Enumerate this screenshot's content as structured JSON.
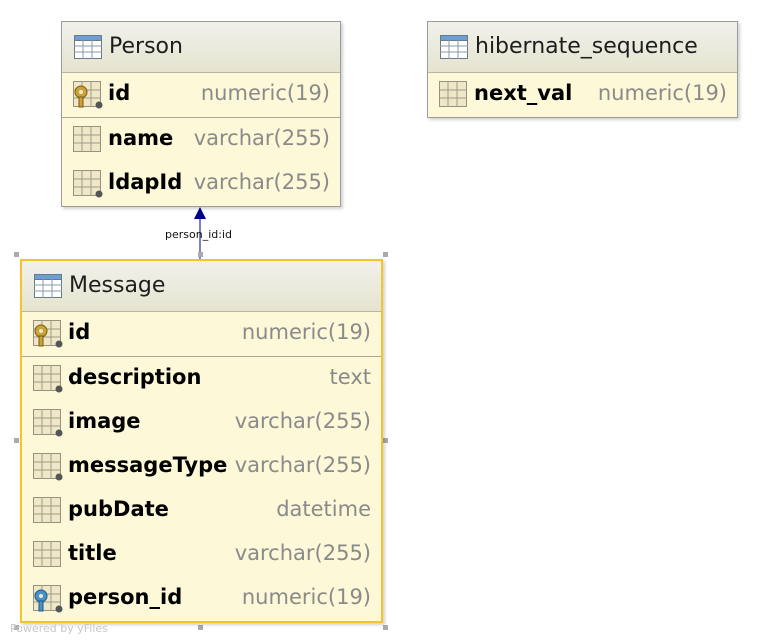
{
  "tables": {
    "person": {
      "name": "Person",
      "pk": [
        {
          "name": "id",
          "type": "numeric(19)"
        }
      ],
      "columns": [
        {
          "name": "name",
          "type": "varchar(255)"
        },
        {
          "name": "ldapId",
          "type": "varchar(255)"
        }
      ]
    },
    "hibernate_sequence": {
      "name": "hibernate_sequence",
      "columns": [
        {
          "name": "next_val",
          "type": "numeric(19)"
        }
      ]
    },
    "message": {
      "name": "Message",
      "pk": [
        {
          "name": "id",
          "type": "numeric(19)"
        }
      ],
      "columns": [
        {
          "name": "description",
          "type": "text"
        },
        {
          "name": "image",
          "type": "varchar(255)"
        },
        {
          "name": "messageType",
          "type": "varchar(255)"
        },
        {
          "name": "pubDate",
          "type": "datetime"
        },
        {
          "name": "title",
          "type": "varchar(255)"
        },
        {
          "name": "person_id",
          "type": "numeric(19)"
        }
      ]
    }
  },
  "relation": {
    "label": "person_id:id"
  },
  "footer": "Powered by yFiles",
  "colors": {
    "table_bg": "#fcf8d8",
    "selected_border": "#f3c52a",
    "arrow": "#00008b",
    "pk_key": "#b08a2a",
    "fk_key": "#4a90c8"
  }
}
